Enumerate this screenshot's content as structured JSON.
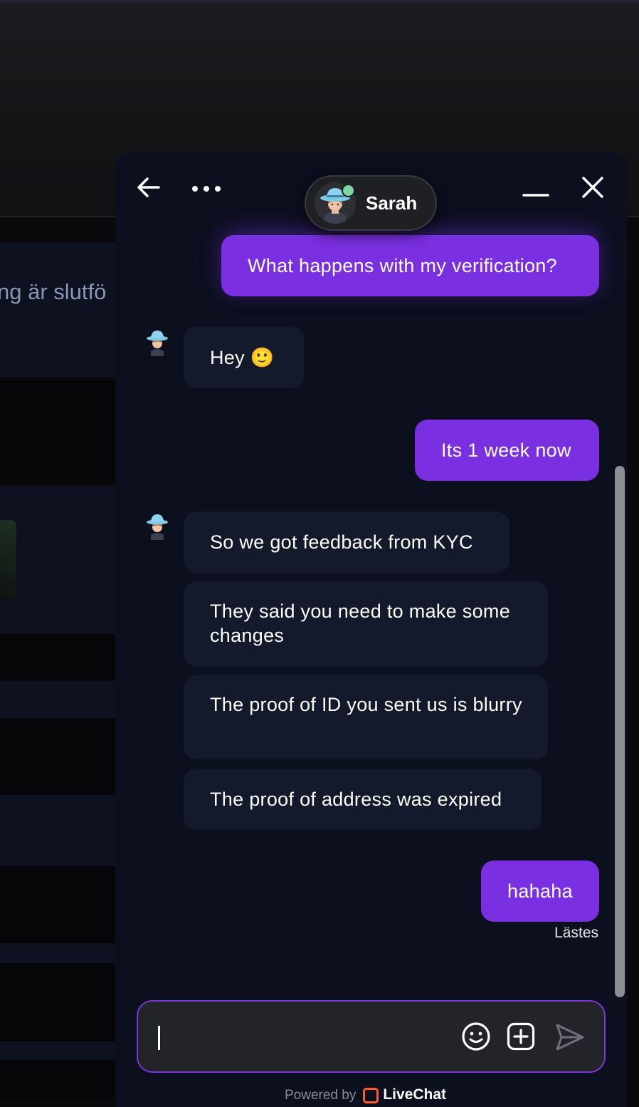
{
  "background": {
    "partial_heading": "ng är slutfö"
  },
  "chat": {
    "agent": {
      "name": "Sarah",
      "status": "online"
    },
    "header_icons": {
      "back": "arrow-left-icon",
      "more": "more-horizontal-icon",
      "minimize": "minimize-icon",
      "close": "close-icon"
    },
    "messages": [
      {
        "from": "visitor",
        "text": "What happens with my verification?"
      },
      {
        "from": "agent",
        "text": "Hey 🙂"
      },
      {
        "from": "visitor",
        "text": "Its 1 week now"
      },
      {
        "from": "agent",
        "text": "So we got feedback from KYC"
      },
      {
        "from": "agent",
        "text": "They said you need to make some changes"
      },
      {
        "from": "agent",
        "text": "The proof of ID you sent us is blurry"
      },
      {
        "from": "agent",
        "text": "The proof of address was expired"
      },
      {
        "from": "visitor",
        "text": "hahaha"
      }
    ],
    "read_status": "Lästes",
    "composer": {
      "value": "",
      "placeholder": ""
    },
    "footer": {
      "powered_by": "Powered by",
      "brand": "LiveChat"
    },
    "colors": {
      "accent": "#7a2fe0",
      "widget_bg": "#0b0f1e",
      "agent_bubble": "#141a2c",
      "online": "#7fd6a0",
      "brand": "#ff5a2a"
    }
  }
}
